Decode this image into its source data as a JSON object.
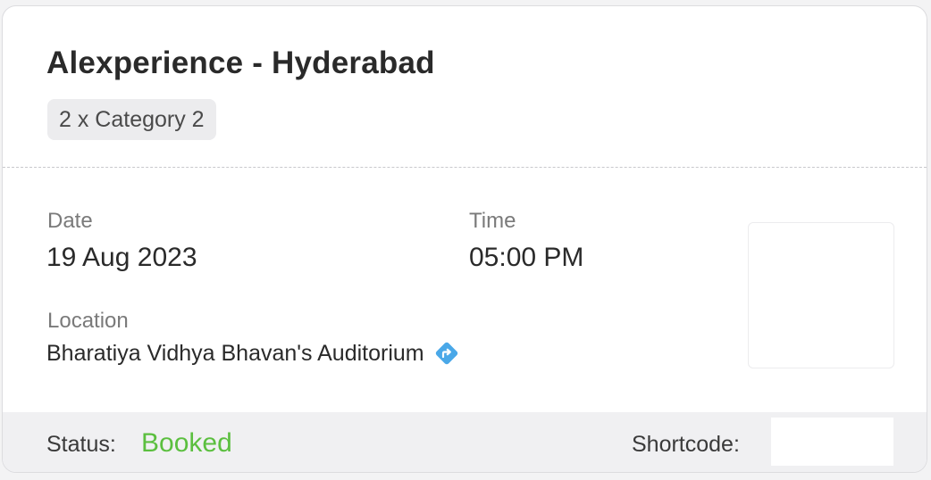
{
  "event": {
    "title": "Alexperience - Hyderabad",
    "ticket_category": "2 x Category 2"
  },
  "details": {
    "date_label": "Date",
    "date_value": "19 Aug 2023",
    "time_label": "Time",
    "time_value": "05:00 PM",
    "location_label": "Location",
    "location_value": "Bharatiya Vidhya Bhavan's Auditorium",
    "directions_icon": "directions-icon"
  },
  "footer": {
    "status_label": "Status:",
    "status_value": "Booked",
    "shortcode_label": "Shortcode:"
  },
  "colors": {
    "status_booked": "#5bbf3f",
    "directions_icon": "#4aa8e8"
  }
}
